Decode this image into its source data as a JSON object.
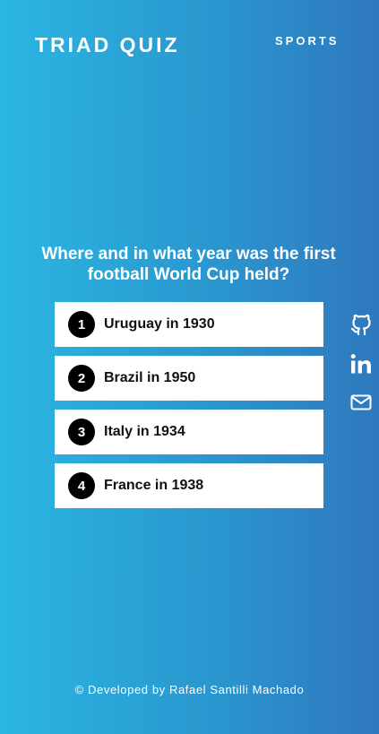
{
  "header": {
    "app_title": "TRIAD QUIZ",
    "category": "SPORTS"
  },
  "quiz": {
    "question": "Where and in what year was the first football World Cup held?",
    "answers": [
      {
        "number": "1",
        "text": "Uruguay in 1930"
      },
      {
        "number": "2",
        "text": "Brazil in 1950"
      },
      {
        "number": "3",
        "text": "Italy in 1934"
      },
      {
        "number": "4",
        "text": "France in 1938"
      }
    ]
  },
  "social": {
    "icons": [
      "github-icon",
      "linkedin-icon",
      "email-icon"
    ]
  },
  "footer": {
    "text": "© Developed by Rafael Santilli Machado"
  },
  "colors": {
    "gradient_start": "#2bb6e2",
    "gradient_end": "#2f78be",
    "answer_background": "#ffffff",
    "number_badge": "#000000"
  }
}
